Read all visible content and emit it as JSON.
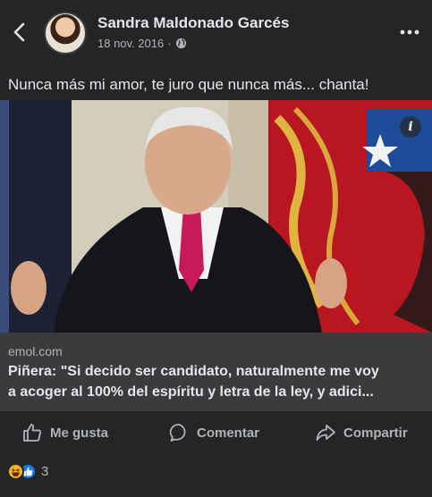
{
  "post": {
    "author": "Sandra Maldonado Garcés",
    "date": "18 nov. 2016",
    "separator": "·",
    "text": "Nunca más mi amor, te juro que nunca más... chanta!"
  },
  "photo": {
    "info_badge": "i"
  },
  "link": {
    "domain": "emol.com",
    "title_line1": "Piñera: \"Si decido ser candidato, naturalmente me voy",
    "title_line2": "a acoger al 100% del espíritu y letra de la ley, y adici..."
  },
  "actions": {
    "like": "Me gusta",
    "comment": "Comentar",
    "share": "Compartir"
  },
  "reactions": {
    "count": "3",
    "icons": [
      "haha-icon",
      "like-icon"
    ]
  },
  "colors": {
    "background": "#242526",
    "card": "#3a3b3c",
    "text_primary": "#e4e6eb",
    "text_secondary": "#b0b3b8",
    "like_blue": "#1877f2",
    "haha_yellow": "#f7b125"
  }
}
